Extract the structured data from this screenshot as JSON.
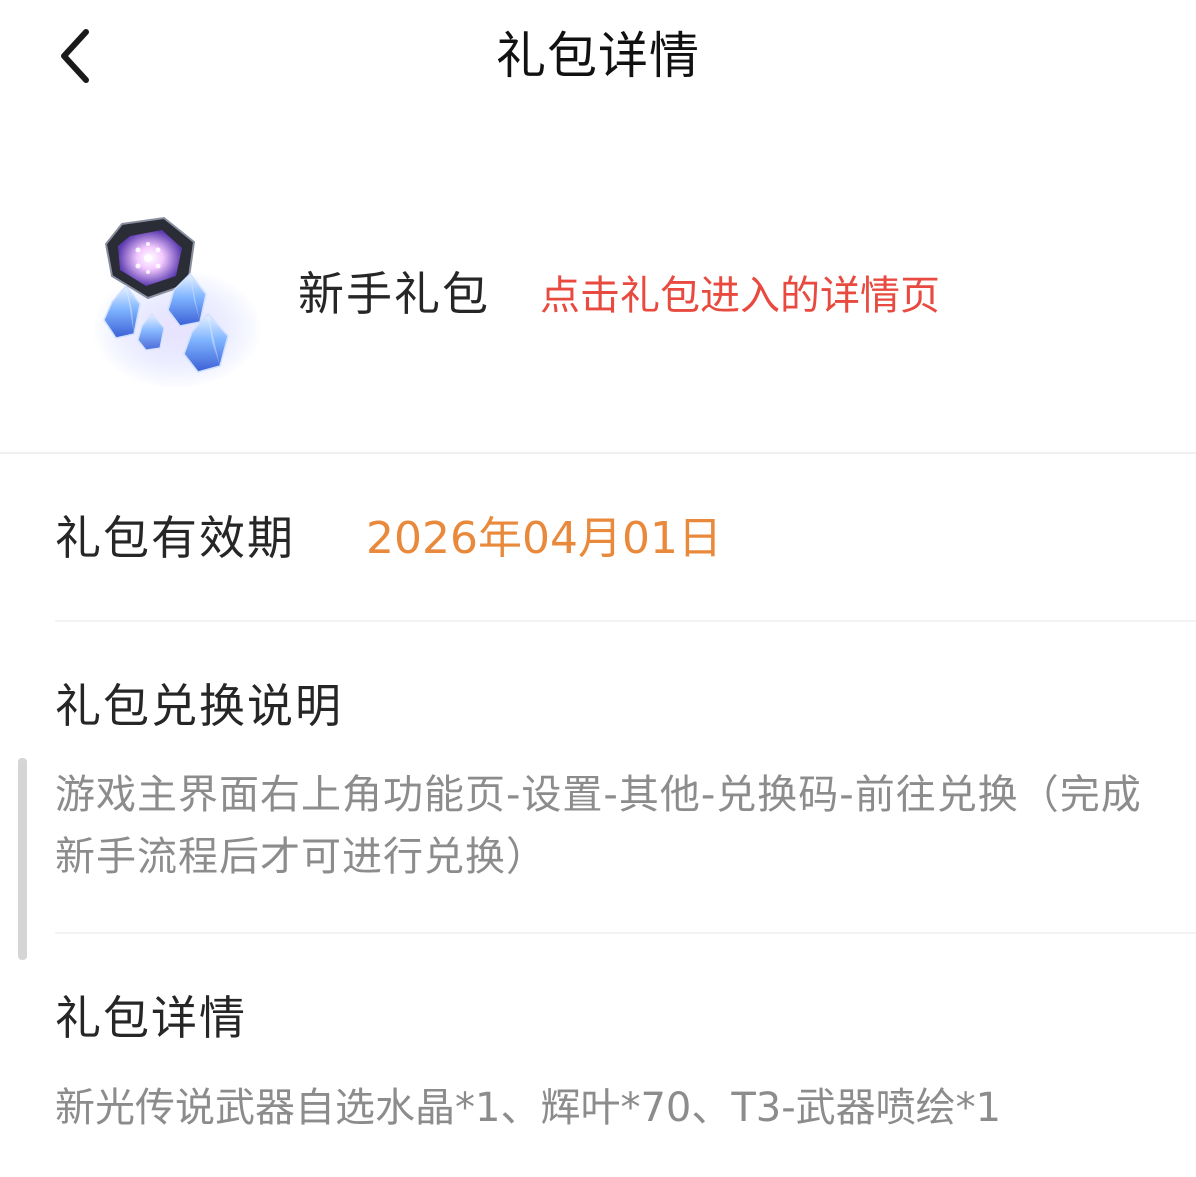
{
  "header": {
    "back_icon": "chevron-left-icon",
    "title": "礼包详情"
  },
  "gift": {
    "icon": "crystal-gift-icon",
    "name": "新手礼包",
    "hint": "点击礼包进入的详情页"
  },
  "validity": {
    "label": "礼包有效期",
    "value": "2026年04月01日"
  },
  "redeem": {
    "heading": "礼包兑换说明",
    "text": "游戏主界面右上角功能页-设置-其他-兑换码-前往兑换（完成新手流程后才可进行兑换）"
  },
  "details": {
    "heading": "礼包详情",
    "text": "新光传说武器自选水晶*1、辉叶*70、T3-武器喷绘*1"
  },
  "colors": {
    "hint_red": "#e84a3f",
    "date_orange": "#e8893c",
    "body_gray": "#8c8c8c",
    "heading_dark": "#262626"
  }
}
